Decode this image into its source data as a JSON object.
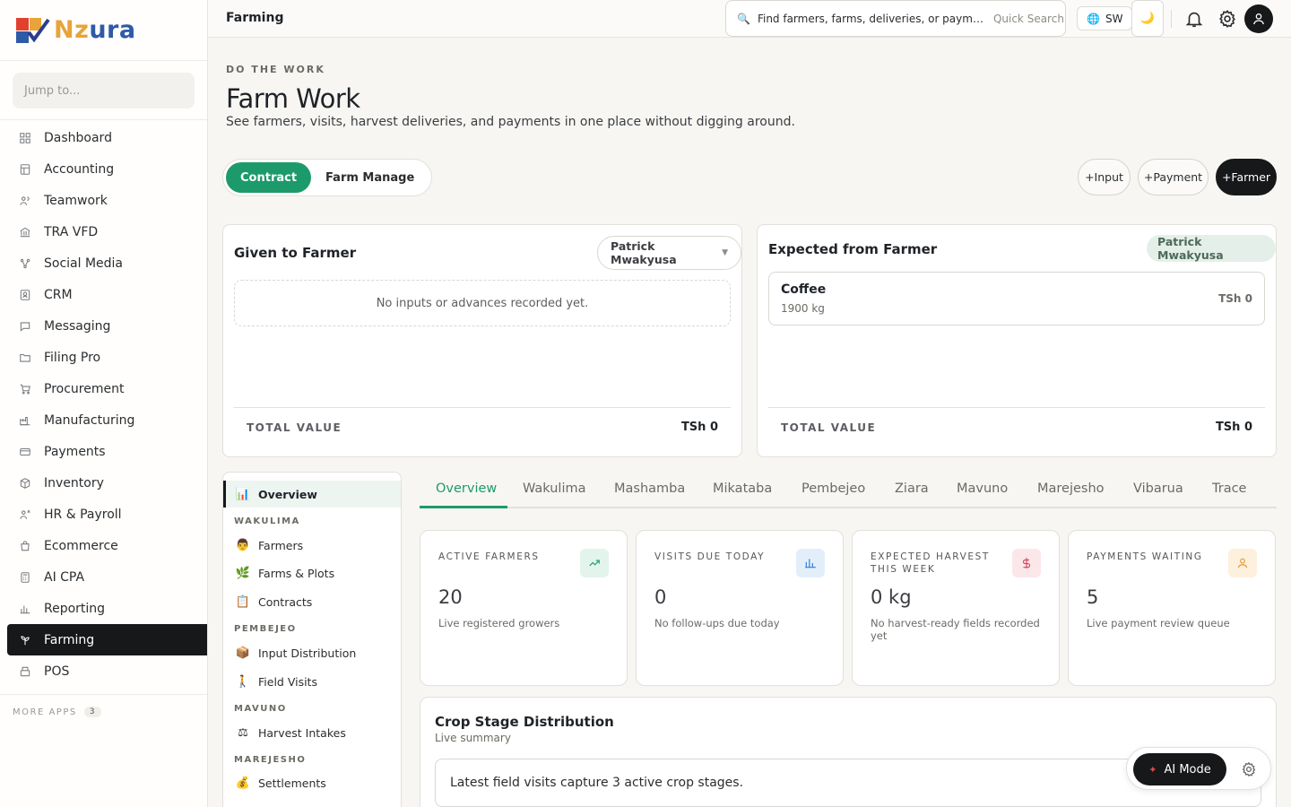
{
  "brand": {
    "logo_text_a": "Nz",
    "logo_text_b": "ura"
  },
  "sidebar": {
    "jump_placeholder": "Jump to...",
    "items": [
      {
        "label": "Dashboard",
        "icon": "grid-icon"
      },
      {
        "label": "Accounting",
        "icon": "ledger-icon"
      },
      {
        "label": "Teamwork",
        "icon": "people-icon"
      },
      {
        "label": "TRA VFD",
        "icon": "bank-icon"
      },
      {
        "label": "Social Media",
        "icon": "share-icon"
      },
      {
        "label": "CRM",
        "icon": "contact-icon"
      },
      {
        "label": "Messaging",
        "icon": "chat-icon"
      },
      {
        "label": "Filing Pro",
        "icon": "folder-icon"
      },
      {
        "label": "Procurement",
        "icon": "cart-icon"
      },
      {
        "label": "Manufacturing",
        "icon": "factory-icon"
      },
      {
        "label": "Payments",
        "icon": "card-icon"
      },
      {
        "label": "Inventory",
        "icon": "box-icon"
      },
      {
        "label": "HR & Payroll",
        "icon": "users-icon"
      },
      {
        "label": "Ecommerce",
        "icon": "bag-icon"
      },
      {
        "label": "AI CPA",
        "icon": "calculator-icon"
      },
      {
        "label": "Reporting",
        "icon": "bar-chart-icon"
      },
      {
        "label": "Farming",
        "icon": "sprout-icon",
        "active": true
      },
      {
        "label": "POS",
        "icon": "register-icon"
      }
    ],
    "more_apps_label": "MORE APPS",
    "more_apps_count": "3"
  },
  "topbar": {
    "title": "Farming",
    "search_placeholder": "Find farmers, farms, deliveries, or payments...",
    "search_hint": "Quick Search",
    "language": "SW",
    "theme_icon": "🌙"
  },
  "header": {
    "eyebrow": "DO THE WORK",
    "title": "Farm Work",
    "subtitle": "See farmers, visits, harvest deliveries, and payments in one place without digging around."
  },
  "mode_toggle": {
    "options": [
      "Contract",
      "Farm Manage"
    ],
    "selected": "Contract"
  },
  "actions": {
    "input": "+Input",
    "payment": "+Payment",
    "farmer": "+Farmer"
  },
  "given_card": {
    "title": "Given to Farmer",
    "farmer_select": "Patrick Mwakyusa",
    "empty": "No inputs or advances recorded yet.",
    "total_label": "TOTAL VALUE",
    "total_value": "TSh 0"
  },
  "expected_card": {
    "title": "Expected from Farmer",
    "farmer_tag": "Patrick Mwakyusa",
    "item_name": "Coffee",
    "item_qty": "1900 kg",
    "item_value": "TSh 0",
    "total_label": "TOTAL VALUE",
    "total_value": "TSh 0"
  },
  "subnav": {
    "overview": {
      "label": "Overview",
      "emoji": "📊"
    },
    "groups": [
      {
        "head": "WAKULIMA",
        "items": [
          {
            "label": "Farmers",
            "emoji": "👨"
          },
          {
            "label": "Farms & Plots",
            "emoji": "🌿"
          },
          {
            "label": "Contracts",
            "emoji": "📋"
          }
        ]
      },
      {
        "head": "PEMBEJEO",
        "items": [
          {
            "label": "Input Distribution",
            "emoji": "📦"
          },
          {
            "label": "Field Visits",
            "emoji": "🚶"
          }
        ]
      },
      {
        "head": "MAVUNO",
        "items": [
          {
            "label": "Harvest Intakes",
            "emoji": "⚖"
          }
        ]
      },
      {
        "head": "MAREJESHO",
        "items": [
          {
            "label": "Settlements",
            "emoji": "💰"
          }
        ]
      }
    ]
  },
  "tabs": [
    "Overview",
    "Wakulima",
    "Mashamba",
    "Mikataba",
    "Pembejeo",
    "Ziara",
    "Mavuno",
    "Marejesho",
    "Vibarua",
    "Trace"
  ],
  "stats": [
    {
      "label": "ACTIVE FARMERS",
      "value": "20",
      "desc": "Live registered growers",
      "icon": "trend-up-icon",
      "color": "#22a06b",
      "bg": "#e3f4ec"
    },
    {
      "label": "VISITS DUE TODAY",
      "value": "0",
      "desc": "No follow-ups due today",
      "icon": "bar-chart-icon",
      "color": "#2f7fd8",
      "bg": "#e2effb"
    },
    {
      "label": "EXPECTED HARVEST THIS WEEK",
      "value": "0 kg",
      "desc": "No harvest-ready fields recorded yet",
      "icon": "dollar-icon",
      "color": "#d8455a",
      "bg": "#fbe6e9"
    },
    {
      "label": "PAYMENTS WAITING",
      "value": "5",
      "desc": "Live payment review queue",
      "icon": "person-icon",
      "color": "#e49a3b",
      "bg": "#fdf0dd"
    }
  ],
  "crop": {
    "title": "Crop Stage Distribution",
    "subtitle": "Live summary",
    "summary": "Latest field visits capture 3 active crop stages."
  },
  "ai": {
    "label": "AI Mode"
  },
  "colors": {
    "accent": "#1d9a6c",
    "dark": "#161819",
    "logo_orange": "#e8a33a",
    "logo_blue": "#2e5aa8"
  }
}
